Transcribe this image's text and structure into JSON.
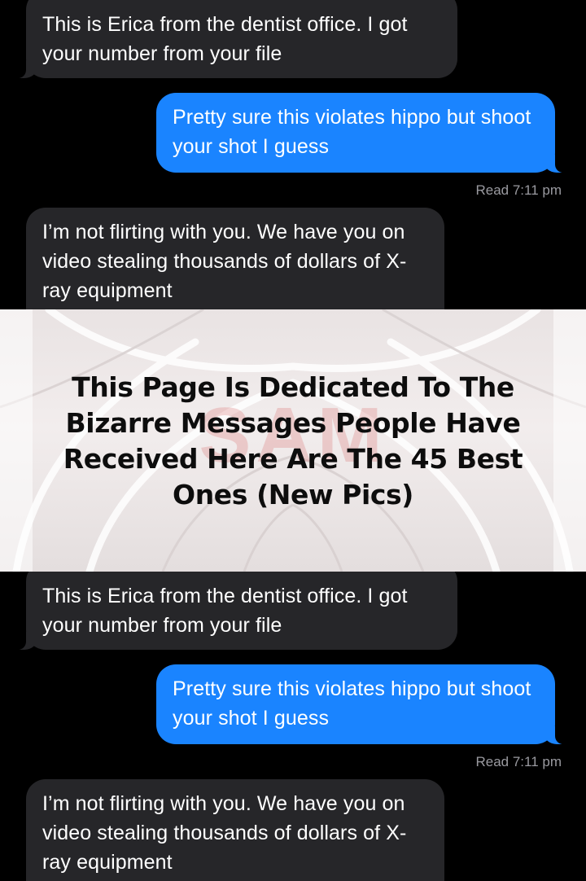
{
  "threads": [
    {
      "incoming_1": "This is Erica from the dentist office. I got your number from your file",
      "outgoing_1": "Pretty sure this violates hippo but shoot your shot I guess",
      "read_receipt": "Read 7:11 pm",
      "incoming_2": "I’m not flirting with you. We have you on video stealing thousands of dollars of X-ray equipment"
    },
    {
      "incoming_1": "This is Erica from the dentist office. I got your number from your file",
      "outgoing_1": "Pretty sure this violates hippo but shoot your shot I guess",
      "read_receipt": "Read 7:11 pm",
      "incoming_2": "I’m not flirting with you. We have you on video stealing thousands of dollars of X-ray equipment"
    }
  ],
  "banner": {
    "headline": "This Page Is Dedicated To The Bizarre Messages People Have Received Here Are The 45 Best Ones (New Pics)",
    "watermark": "SAM"
  },
  "colors": {
    "background": "#000000",
    "incoming_bubble": "#262629",
    "outgoing_bubble": "#1a84ff",
    "read_receipt": "#9a9aa0"
  }
}
